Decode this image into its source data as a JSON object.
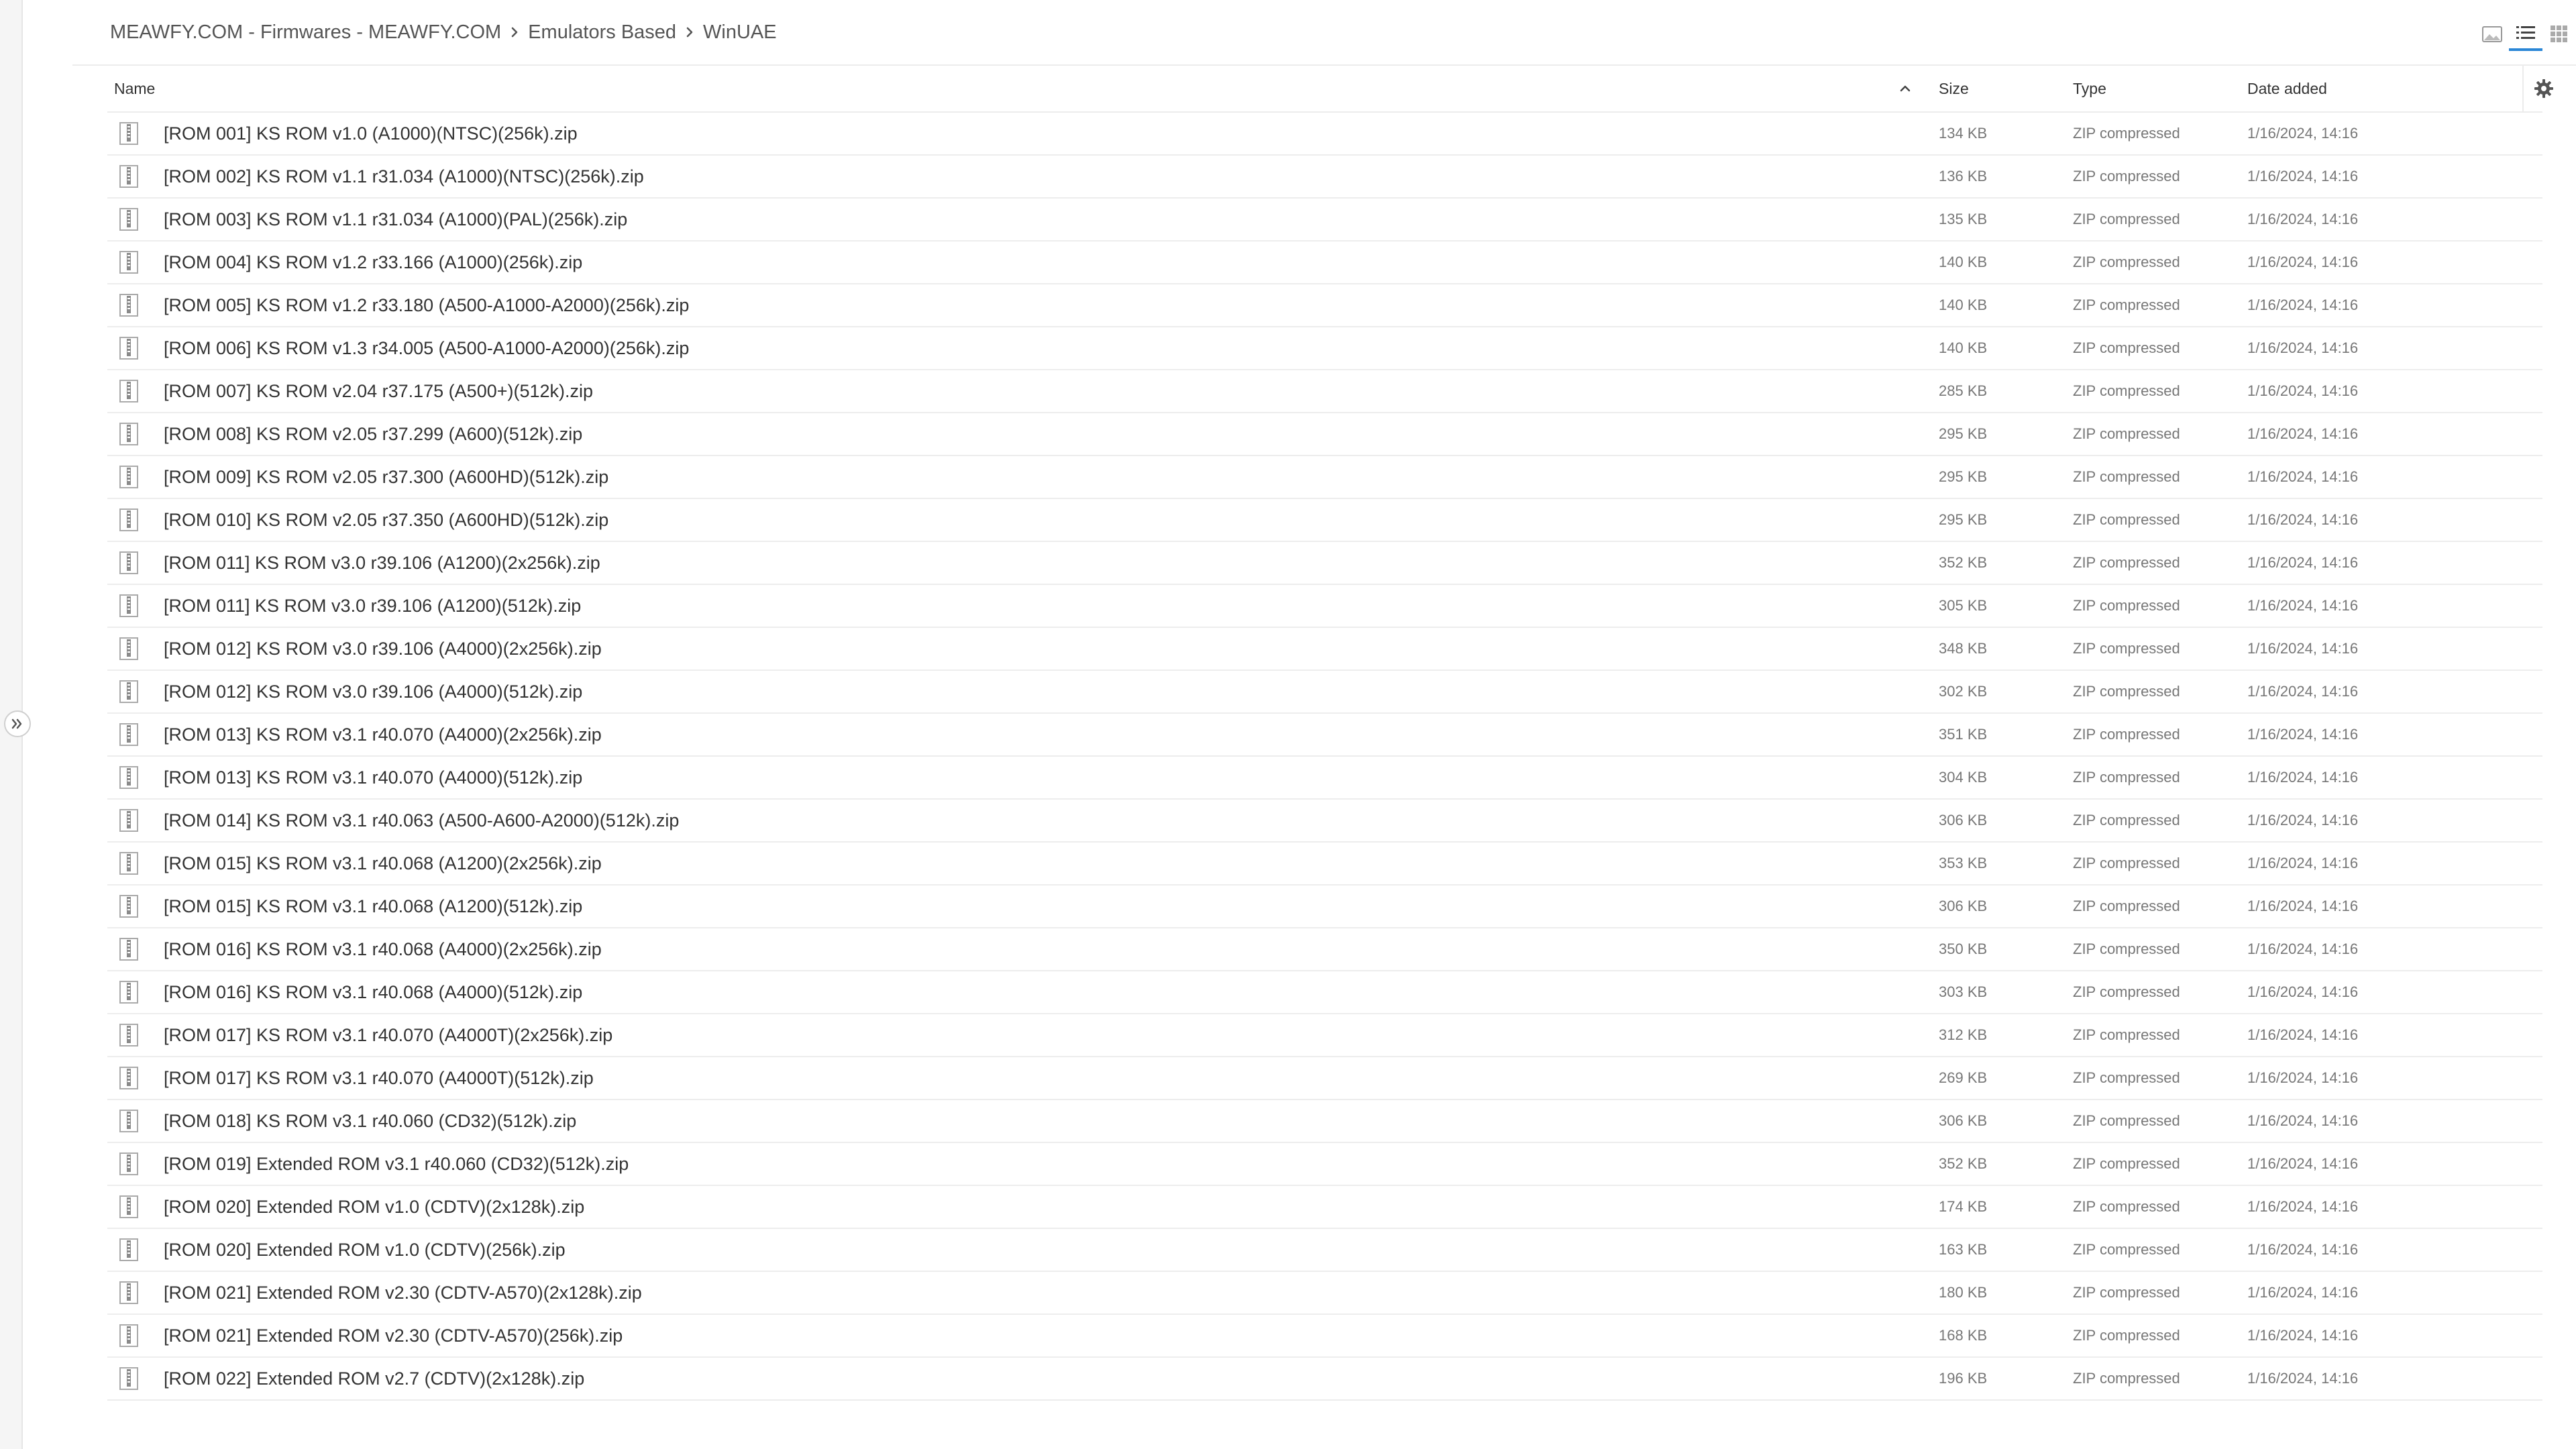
{
  "breadcrumb": [
    "MEAWFY.COM - Firmwares - MEAWFY.COM",
    "Emulators Based",
    "WinUAE"
  ],
  "view_modes": [
    "thumbnails-view",
    "list-view",
    "grid-view"
  ],
  "active_view": "list-view",
  "columns": {
    "name": "Name",
    "size": "Size",
    "type": "Type",
    "date": "Date added"
  },
  "sort": {
    "column": "Name",
    "direction": "ascending"
  },
  "files": [
    {
      "name": "[ROM 001] KS ROM v1.0 (A1000)(NTSC)(256k).zip",
      "size": "134 KB",
      "type": "ZIP compressed",
      "date": "1/16/2024, 14:16"
    },
    {
      "name": "[ROM 002] KS ROM v1.1 r31.034 (A1000)(NTSC)(256k).zip",
      "size": "136 KB",
      "type": "ZIP compressed",
      "date": "1/16/2024, 14:16"
    },
    {
      "name": "[ROM 003] KS ROM v1.1 r31.034 (A1000)(PAL)(256k).zip",
      "size": "135 KB",
      "type": "ZIP compressed",
      "date": "1/16/2024, 14:16"
    },
    {
      "name": "[ROM 004] KS ROM v1.2 r33.166 (A1000)(256k).zip",
      "size": "140 KB",
      "type": "ZIP compressed",
      "date": "1/16/2024, 14:16"
    },
    {
      "name": "[ROM 005] KS ROM v1.2 r33.180 (A500-A1000-A2000)(256k).zip",
      "size": "140 KB",
      "type": "ZIP compressed",
      "date": "1/16/2024, 14:16"
    },
    {
      "name": "[ROM 006] KS ROM v1.3 r34.005 (A500-A1000-A2000)(256k).zip",
      "size": "140 KB",
      "type": "ZIP compressed",
      "date": "1/16/2024, 14:16"
    },
    {
      "name": "[ROM 007] KS ROM v2.04 r37.175 (A500+)(512k).zip",
      "size": "285 KB",
      "type": "ZIP compressed",
      "date": "1/16/2024, 14:16"
    },
    {
      "name": "[ROM 008] KS ROM v2.05 r37.299 (A600)(512k).zip",
      "size": "295 KB",
      "type": "ZIP compressed",
      "date": "1/16/2024, 14:16"
    },
    {
      "name": "[ROM 009] KS ROM v2.05 r37.300 (A600HD)(512k).zip",
      "size": "295 KB",
      "type": "ZIP compressed",
      "date": "1/16/2024, 14:16"
    },
    {
      "name": "[ROM 010] KS ROM v2.05 r37.350 (A600HD)(512k).zip",
      "size": "295 KB",
      "type": "ZIP compressed",
      "date": "1/16/2024, 14:16"
    },
    {
      "name": "[ROM 011] KS ROM v3.0 r39.106 (A1200)(2x256k).zip",
      "size": "352 KB",
      "type": "ZIP compressed",
      "date": "1/16/2024, 14:16"
    },
    {
      "name": "[ROM 011] KS ROM v3.0 r39.106 (A1200)(512k).zip",
      "size": "305 KB",
      "type": "ZIP compressed",
      "date": "1/16/2024, 14:16"
    },
    {
      "name": "[ROM 012] KS ROM v3.0 r39.106 (A4000)(2x256k).zip",
      "size": "348 KB",
      "type": "ZIP compressed",
      "date": "1/16/2024, 14:16"
    },
    {
      "name": "[ROM 012] KS ROM v3.0 r39.106 (A4000)(512k).zip",
      "size": "302 KB",
      "type": "ZIP compressed",
      "date": "1/16/2024, 14:16"
    },
    {
      "name": "[ROM 013] KS ROM v3.1 r40.070 (A4000)(2x256k).zip",
      "size": "351 KB",
      "type": "ZIP compressed",
      "date": "1/16/2024, 14:16"
    },
    {
      "name": "[ROM 013] KS ROM v3.1 r40.070 (A4000)(512k).zip",
      "size": "304 KB",
      "type": "ZIP compressed",
      "date": "1/16/2024, 14:16"
    },
    {
      "name": "[ROM 014] KS ROM v3.1 r40.063 (A500-A600-A2000)(512k).zip",
      "size": "306 KB",
      "type": "ZIP compressed",
      "date": "1/16/2024, 14:16"
    },
    {
      "name": "[ROM 015] KS ROM v3.1 r40.068 (A1200)(2x256k).zip",
      "size": "353 KB",
      "type": "ZIP compressed",
      "date": "1/16/2024, 14:16"
    },
    {
      "name": "[ROM 015] KS ROM v3.1 r40.068 (A1200)(512k).zip",
      "size": "306 KB",
      "type": "ZIP compressed",
      "date": "1/16/2024, 14:16"
    },
    {
      "name": "[ROM 016] KS ROM v3.1 r40.068 (A4000)(2x256k).zip",
      "size": "350 KB",
      "type": "ZIP compressed",
      "date": "1/16/2024, 14:16"
    },
    {
      "name": "[ROM 016] KS ROM v3.1 r40.068 (A4000)(512k).zip",
      "size": "303 KB",
      "type": "ZIP compressed",
      "date": "1/16/2024, 14:16"
    },
    {
      "name": "[ROM 017] KS ROM v3.1 r40.070 (A4000T)(2x256k).zip",
      "size": "312 KB",
      "type": "ZIP compressed",
      "date": "1/16/2024, 14:16"
    },
    {
      "name": "[ROM 017] KS ROM v3.1 r40.070 (A4000T)(512k).zip",
      "size": "269 KB",
      "type": "ZIP compressed",
      "date": "1/16/2024, 14:16"
    },
    {
      "name": "[ROM 018] KS ROM v3.1 r40.060 (CD32)(512k).zip",
      "size": "306 KB",
      "type": "ZIP compressed",
      "date": "1/16/2024, 14:16"
    },
    {
      "name": "[ROM 019] Extended ROM v3.1 r40.060 (CD32)(512k).zip",
      "size": "352 KB",
      "type": "ZIP compressed",
      "date": "1/16/2024, 14:16"
    },
    {
      "name": "[ROM 020] Extended ROM v1.0 (CDTV)(2x128k).zip",
      "size": "174 KB",
      "type": "ZIP compressed",
      "date": "1/16/2024, 14:16"
    },
    {
      "name": "[ROM 020] Extended ROM v1.0 (CDTV)(256k).zip",
      "size": "163 KB",
      "type": "ZIP compressed",
      "date": "1/16/2024, 14:16"
    },
    {
      "name": "[ROM 021] Extended ROM v2.30 (CDTV-A570)(2x128k).zip",
      "size": "180 KB",
      "type": "ZIP compressed",
      "date": "1/16/2024, 14:16"
    },
    {
      "name": "[ROM 021] Extended ROM v2.30 (CDTV-A570)(256k).zip",
      "size": "168 KB",
      "type": "ZIP compressed",
      "date": "1/16/2024, 14:16"
    },
    {
      "name": "[ROM 022] Extended ROM v2.7 (CDTV)(2x128k).zip",
      "size": "196 KB",
      "type": "ZIP compressed",
      "date": "1/16/2024, 14:16"
    }
  ]
}
